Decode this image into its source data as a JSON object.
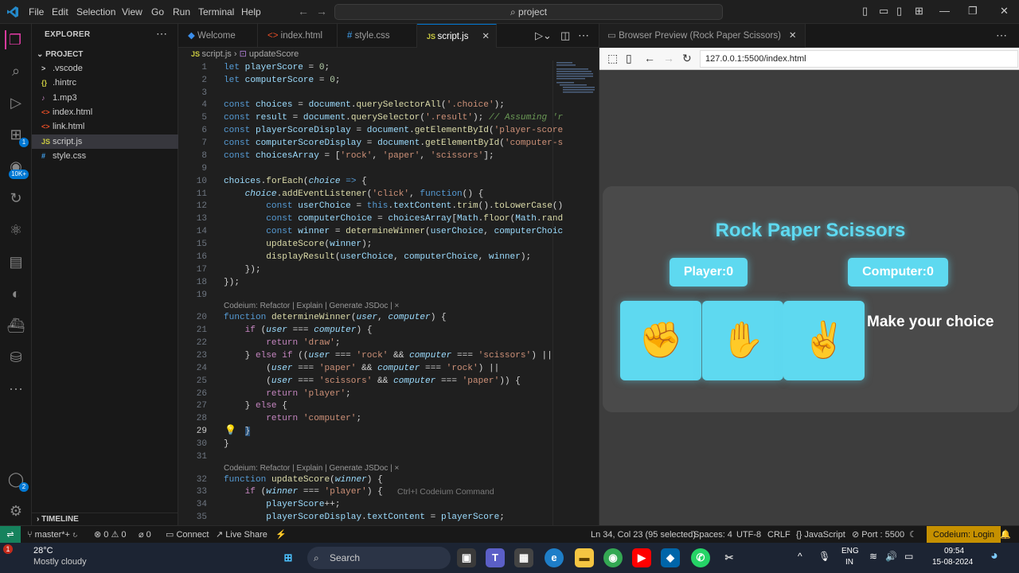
{
  "titlebar": {
    "menus": [
      "File",
      "Edit",
      "Selection",
      "View",
      "Go",
      "Run",
      "Terminal",
      "Help"
    ],
    "search": "project"
  },
  "activity": {
    "badge_ext": "1",
    "badge_accounts": "10K+",
    "badge_account": "2"
  },
  "sidebar": {
    "header": "EXPLORER",
    "project": "PROJECT",
    "files": [
      {
        "icon": ">",
        "name": ".vscode"
      },
      {
        "icon": "{}",
        "name": ".hintrc"
      },
      {
        "icon": "♪",
        "name": "1.mp3"
      },
      {
        "icon": "<>",
        "name": "index.html"
      },
      {
        "icon": "<>",
        "name": "link.html"
      },
      {
        "icon": "JS",
        "name": "script.js"
      },
      {
        "icon": "#",
        "name": "style.css"
      }
    ],
    "timeline": "TIMELINE"
  },
  "tabs": [
    "Welcome",
    "index.html",
    "style.css",
    "script.js"
  ],
  "breadcrumb": {
    "file": "script.js",
    "symbol": "updateScore"
  },
  "editor": {
    "lens": "Codeium: Refactor | Explain | Generate JSDoc | ×",
    "hint": "Ctrl+I Codeium Command"
  },
  "browser": {
    "tab": "Browser Preview (Rock Paper Scissors)",
    "url": "127.0.0.1:5500/index.html",
    "game": {
      "title": "Rock Paper Scissors",
      "player": "Player:0",
      "computer": "Computer:0",
      "choices": [
        "✊",
        "✋",
        "✌"
      ],
      "result": "Make your choice"
    }
  },
  "statusbar": {
    "branch": "master*+",
    "problems": "⊗ 0 ⚠ 0",
    "ports": "⌀ 0",
    "connect": "Connect",
    "liveshare": "Live Share",
    "position": "Ln 34, Col 23 (95 selected)",
    "spaces": "Spaces: 4",
    "encoding": "UTF-8",
    "eol": "CRLF",
    "language": "JavaScript",
    "port": "Port : 5500",
    "login": "Codeium: Login"
  },
  "taskbar": {
    "temp": "28°C",
    "weather": "Mostly cloudy",
    "weather_badge": "1",
    "search": "Search",
    "lang1": "ENG",
    "lang2": "IN",
    "time": "09:54",
    "date": "15-08-2024"
  }
}
